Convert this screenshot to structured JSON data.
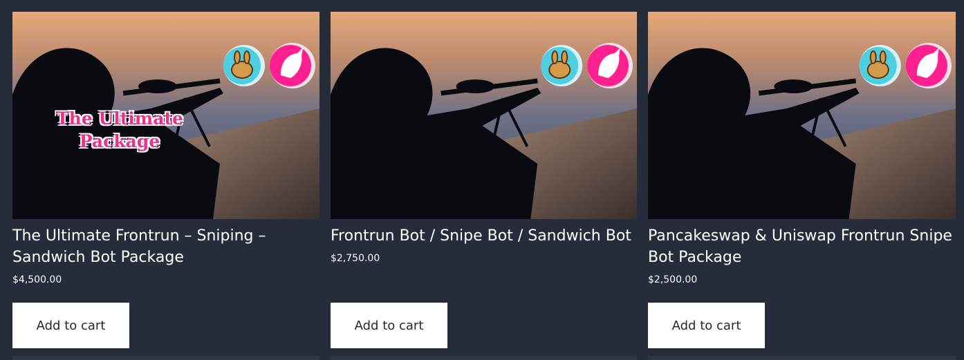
{
  "products": [
    {
      "title": "The Ultimate Frontrun – Sniping – Sandwich Bot Package",
      "price": "$4,500.00",
      "button_label": "Add to cart",
      "image_overlay_text": [
        "The Ultimate",
        "Package"
      ]
    },
    {
      "title": "Frontrun Bot / Snipe Bot / Sandwich Bot",
      "price": "$2,750.00",
      "button_label": "Add to cart"
    },
    {
      "title": "Pancakeswap & Uniswap Frontrun Snipe Bot Package",
      "price": "$2,500.00",
      "button_label": "Add to cart"
    }
  ],
  "colors": {
    "page_background": "#262c3a",
    "button_background": "#ffffff",
    "button_text": "#1f2532",
    "overlay_text_pink": "#e8338a",
    "pancake_badge": "#4ecfe0",
    "uniswap_badge": "#ff1f8e"
  },
  "icons": [
    "pancakeswap-bunny-icon",
    "uniswap-unicorn-icon"
  ]
}
